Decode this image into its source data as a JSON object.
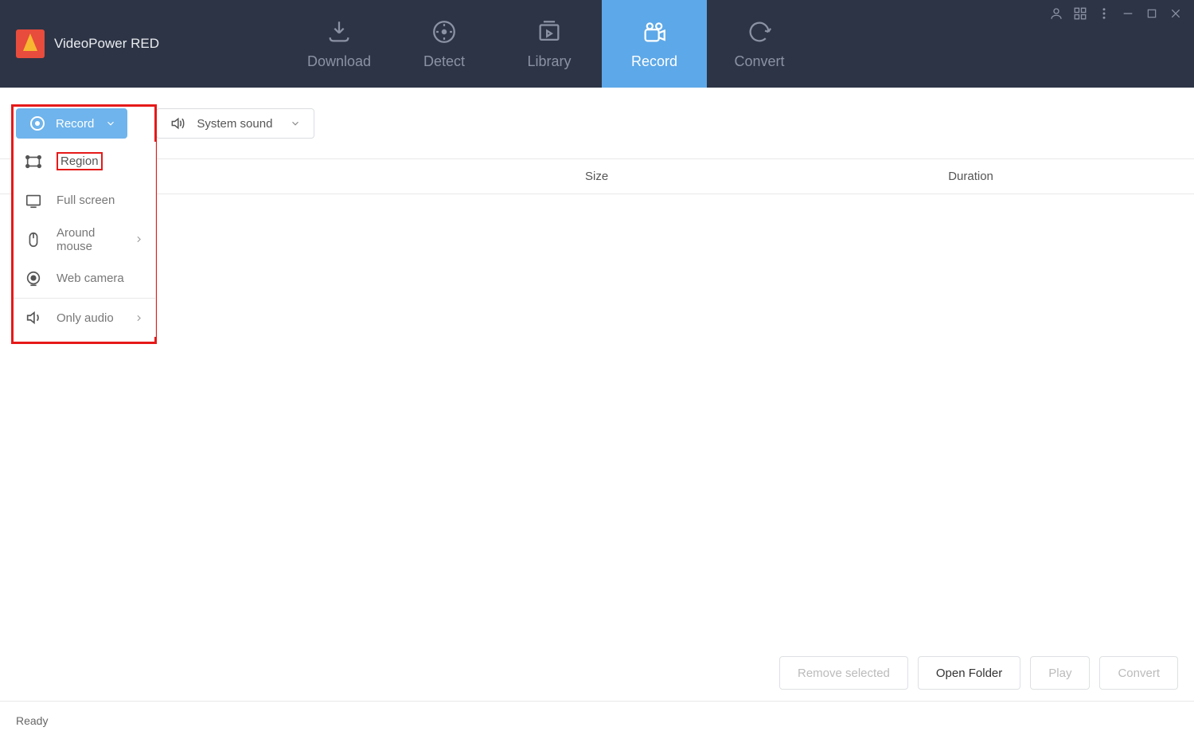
{
  "app": {
    "title": "VideoPower RED"
  },
  "nav": {
    "tabs": [
      {
        "label": "Download",
        "active": false
      },
      {
        "label": "Detect",
        "active": false
      },
      {
        "label": "Library",
        "active": false
      },
      {
        "label": "Record",
        "active": true
      },
      {
        "label": "Convert",
        "active": false
      }
    ]
  },
  "toolbar": {
    "record_label": "Record",
    "sound_label": "System sound"
  },
  "record_dropdown": {
    "items": [
      {
        "label": "Region",
        "icon": "region",
        "highlighted": true
      },
      {
        "label": "Full screen",
        "icon": "fullscreen"
      },
      {
        "label": "Around mouse",
        "icon": "mouse",
        "has_submenu": true
      },
      {
        "label": "Web camera",
        "icon": "webcam"
      },
      {
        "label": "Only audio",
        "icon": "audio",
        "has_submenu": true,
        "divider": true
      }
    ]
  },
  "table": {
    "columns": {
      "size": "Size",
      "duration": "Duration"
    }
  },
  "actions": {
    "remove_selected": "Remove selected",
    "open_folder": "Open Folder",
    "play": "Play",
    "convert": "Convert"
  },
  "status": {
    "text": "Ready"
  }
}
